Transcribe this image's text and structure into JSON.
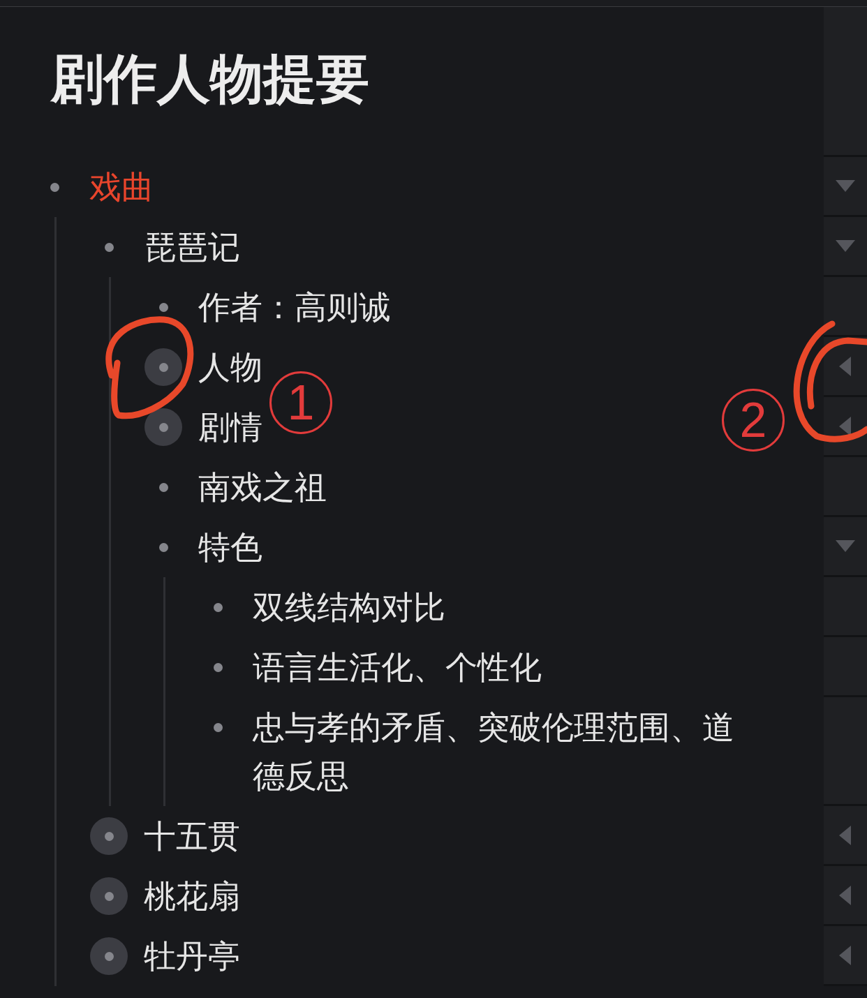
{
  "title": "剧作人物提要",
  "outline": [
    {
      "text": "戏曲",
      "color": "#e8452c",
      "kind": "parent",
      "expanded": true,
      "children": [
        {
          "text": "琵琶记",
          "kind": "parent",
          "expanded": true,
          "children": [
            {
              "text": "作者：高则诚",
              "kind": "leaf"
            },
            {
              "text": "人物",
              "kind": "parent",
              "expanded": false
            },
            {
              "text": "剧情",
              "kind": "parent",
              "expanded": false
            },
            {
              "text": "南戏之祖",
              "kind": "leaf"
            },
            {
              "text": "特色",
              "kind": "parent",
              "expanded": true,
              "children": [
                {
                  "text": "双线结构对比",
                  "kind": "leaf"
                },
                {
                  "text": "语言生活化、个性化",
                  "kind": "leaf"
                },
                {
                  "text": "忠与孝的矛盾、突破伦理范围、道德反思",
                  "kind": "leaf"
                }
              ]
            }
          ]
        },
        {
          "text": "十五贯",
          "kind": "parent",
          "expanded": false
        },
        {
          "text": "桃花扇",
          "kind": "parent",
          "expanded": false
        },
        {
          "text": "牡丹亭",
          "kind": "parent",
          "expanded": false
        }
      ]
    }
  ],
  "annotations": [
    {
      "label": "1"
    },
    {
      "label": "2"
    }
  ]
}
